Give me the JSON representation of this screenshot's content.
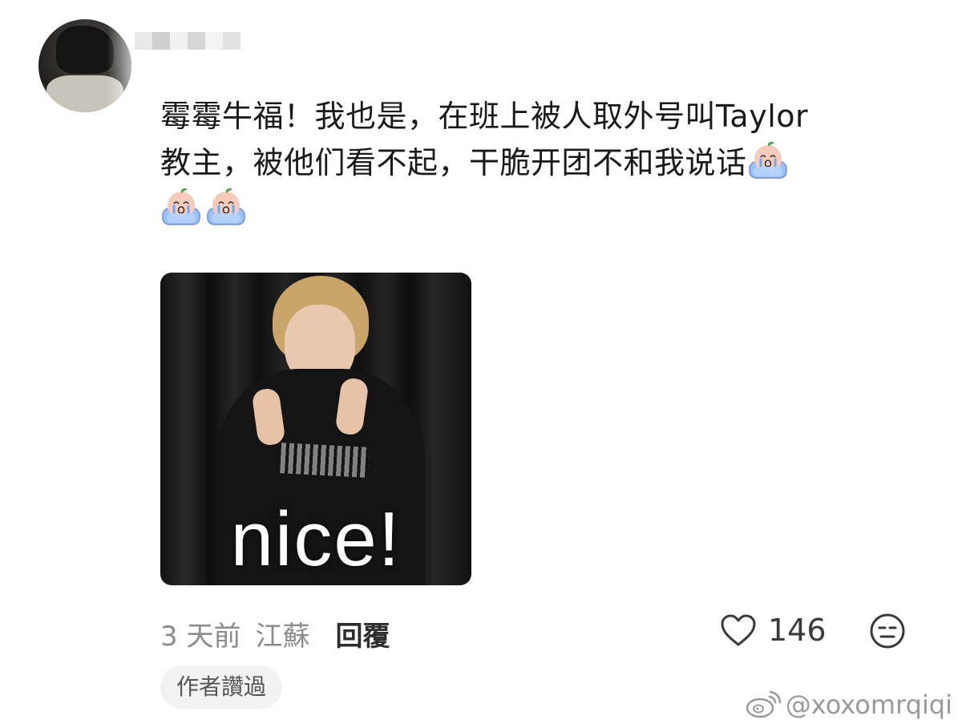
{
  "comment": {
    "username_masked": true,
    "lines": [
      "霉霉牛福！我也是，在班上被人取外号叫Taylor",
      "教主，被他们看不起，干脆开团不和我说话"
    ],
    "emoji_name": "crying-peach-emoji",
    "sticker_caption": "nice!"
  },
  "meta": {
    "time": "3 天前",
    "location": "江蘇",
    "reply_label": "回覆"
  },
  "like": {
    "count": "146"
  },
  "author_badge": "作者讚過",
  "watermark": "@xoxomrqiqi",
  "colors": {
    "meta_gray": "#8c8c8c",
    "badge_bg": "#f2f2f2",
    "emoji_blue": "#8fb4f5",
    "emoji_peach": "#f6c2b1"
  }
}
